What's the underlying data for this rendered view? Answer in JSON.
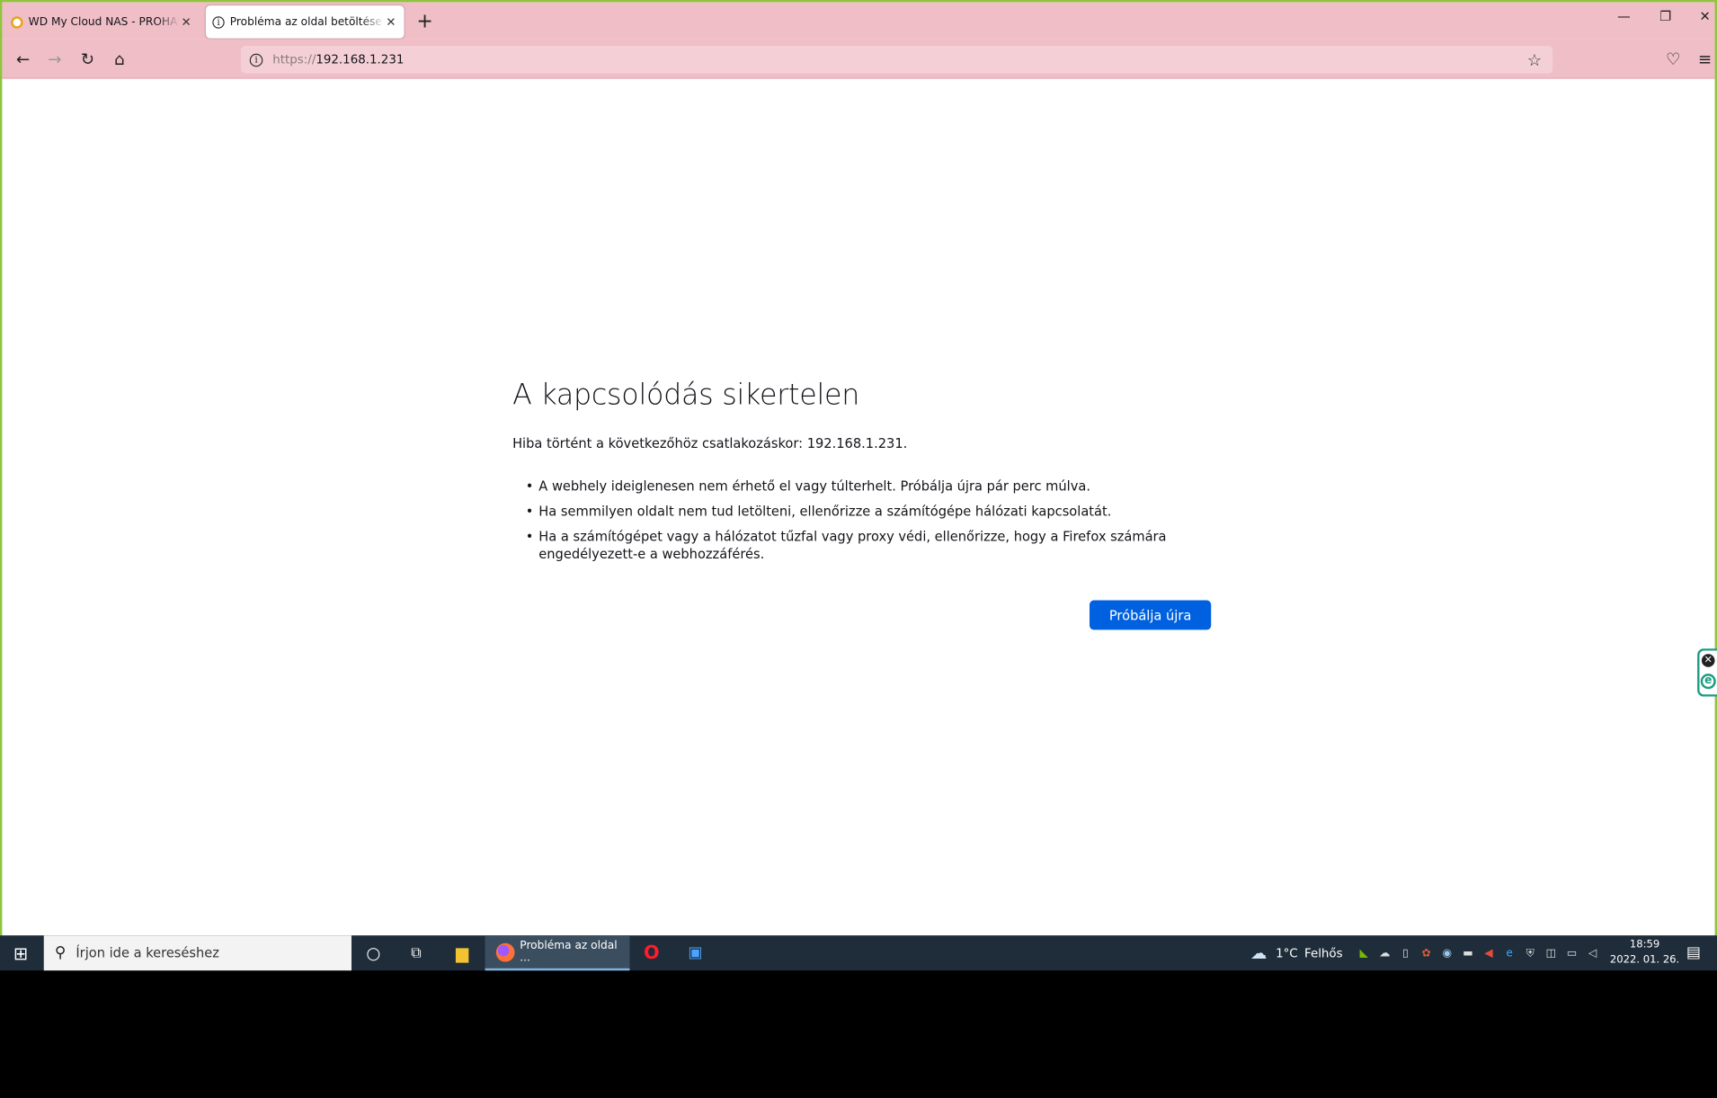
{
  "tabs": [
    {
      "title": "WD My Cloud NAS - PROHARD",
      "active": false
    },
    {
      "title": "Probléma az oldal betöltése közben",
      "active": true
    }
  ],
  "navbar": {
    "url_protocol": "https://",
    "url_host": "192.168.1.231"
  },
  "error": {
    "title": "A kapcsolódás sikertelen",
    "description": "Hiba történt a következőhöz csatlakozáskor: 192.168.1.231.",
    "bullets": [
      "A webhely ideiglenesen nem érhető el vagy túlterhelt. Próbálja újra pár perc múlva.",
      "Ha semmilyen oldalt nem tud letölteni, ellenőrizze a számítógépe hálózati kapcsolatát.",
      "Ha a számítógépet vagy a hálózatot tűzfal vagy proxy védi, ellenőrizze, hogy a Firefox számára engedélyezett-e a webhozzáférés."
    ],
    "retry_label": "Próbálja újra"
  },
  "taskbar": {
    "search_placeholder": "Írjon ide a kereséshez",
    "firefox_task_label": "Probléma az oldal ...",
    "weather_temp": "1°C",
    "weather_text": "Felhős",
    "time": "18:59",
    "date": "2022. 01. 26."
  },
  "colors": {
    "accent": "#0061e0",
    "chrome": "#f0bec7",
    "taskbar": "#1f2d3a"
  }
}
